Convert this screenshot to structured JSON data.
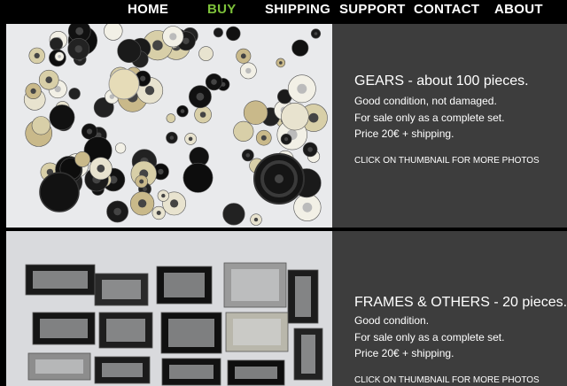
{
  "nav": {
    "items": [
      {
        "label": "HOME"
      },
      {
        "label": "BUY"
      },
      {
        "label": "SHIPPING"
      },
      {
        "label": "SUPPORT"
      },
      {
        "label": "CONTACT"
      },
      {
        "label": "ABOUT"
      }
    ],
    "active_color": "#7dc13a"
  },
  "listings": [
    {
      "title": "GEARS - about 100 pieces.",
      "lines": [
        "Good condition, not damaged.",
        "For sale only as a complete set.",
        "Price 20€ + shipping."
      ],
      "cta": "CLICK ON THUMBNAIL FOR MORE PHOTOS"
    },
    {
      "title": "FRAMES & OTHERS - 20 pieces.",
      "lines": [
        "Good condition.",
        "For sale only as a complete set.",
        "Price 20€ + shipping."
      ],
      "cta": "CLICK ON THUMBNAIL FOR MORE PHOTOS"
    }
  ],
  "colors": {
    "panel": "#3d3d3d",
    "accent": "#7dc13a"
  }
}
